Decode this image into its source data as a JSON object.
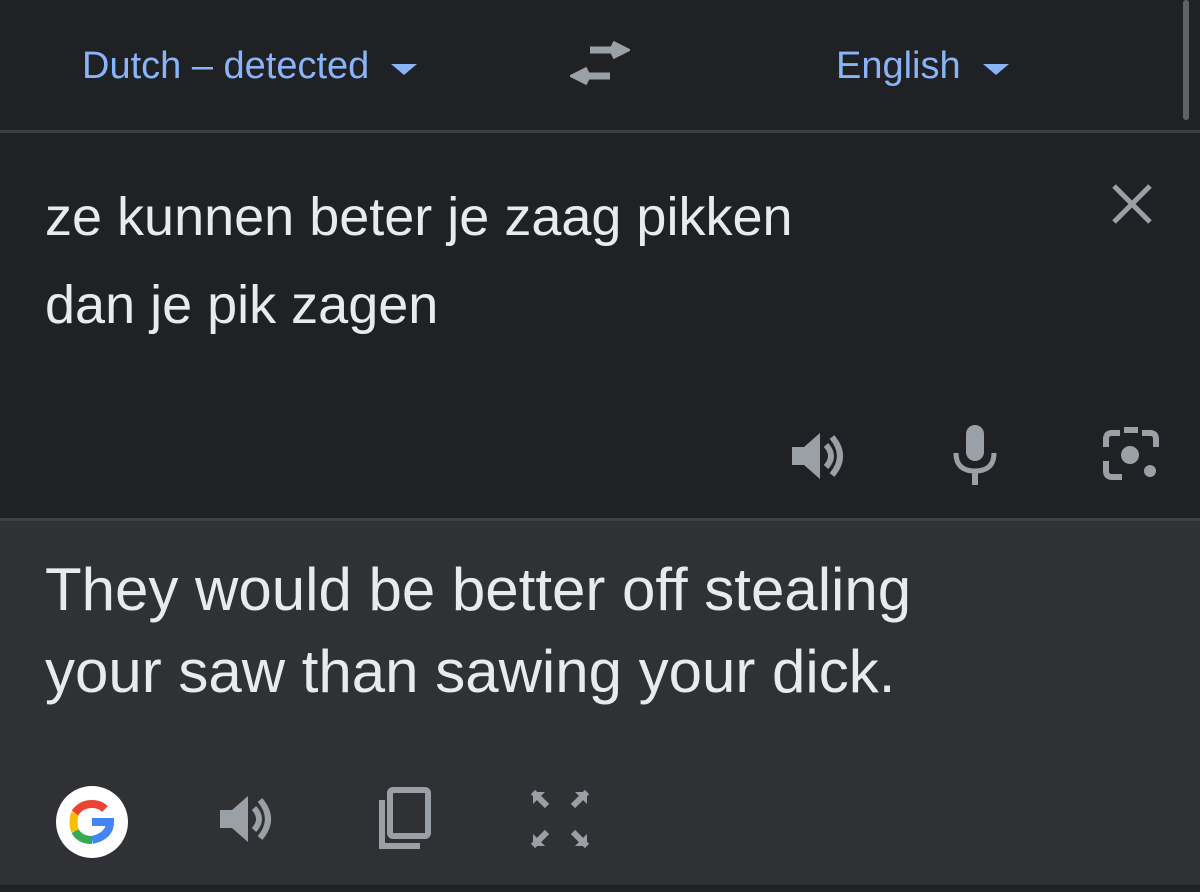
{
  "languages": {
    "source": "Dutch – detected",
    "target": "English"
  },
  "source": {
    "line1": "ze kunnen beter je zaag pikken",
    "line2": "dan je pik zagen"
  },
  "translation": {
    "line1": "They would be better off stealing",
    "line2": "your saw than sawing your dick."
  },
  "colors": {
    "accent": "#8ab4f8",
    "text": "#e8eaed",
    "icon": "#9aa0a6",
    "background": "#202124",
    "translation_background": "#303134"
  },
  "icons": {
    "swap": "swap-languages-icon",
    "clear": "close-icon",
    "source_listen": "speaker-icon",
    "mic": "microphone-icon",
    "camera": "camera-lens-icon",
    "google": "google-logo-icon",
    "target_listen": "speaker-icon",
    "copy": "copy-icon",
    "fullscreen": "fullscreen-icon"
  }
}
